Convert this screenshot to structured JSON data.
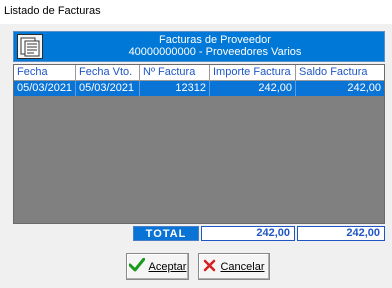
{
  "window": {
    "title": "Listado de Facturas"
  },
  "header": {
    "icon": "invoice-document-icon",
    "line1": "Facturas de Proveedor",
    "line2": "40000000000 - Proveedores Varios"
  },
  "table": {
    "columns": [
      "Fecha",
      "Fecha Vto.",
      "Nº Factura",
      "Importe Factura",
      "Saldo Factura"
    ],
    "rows": [
      [
        "05/03/2021",
        "05/03/2021",
        "12312",
        "242,00",
        "242,00"
      ]
    ]
  },
  "totals": {
    "label": "TOTAL",
    "importe": "242,00",
    "saldo": "242,00"
  },
  "buttons": {
    "accept": {
      "label": "Aceptar",
      "icon": "checkmark-icon"
    },
    "cancel": {
      "label": "Cancelar",
      "icon": "x-cross-icon"
    }
  },
  "colors": {
    "selection": "#0a74d6",
    "header_text": "#1f56c5",
    "grid_background": "#808080"
  }
}
